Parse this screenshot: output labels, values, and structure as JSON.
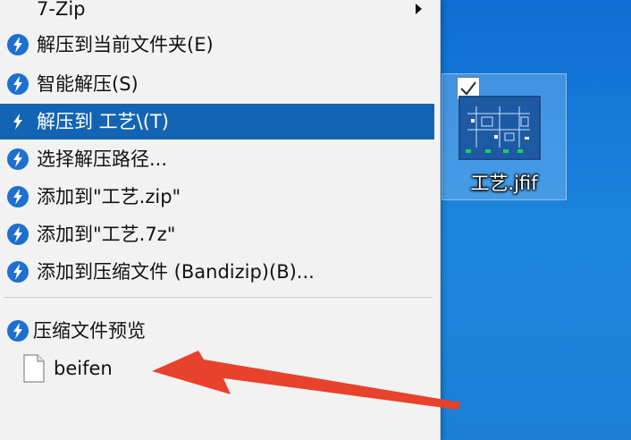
{
  "context_menu": {
    "items": [
      {
        "label": "7-Zip",
        "has_submenu": true,
        "icon": "none"
      },
      {
        "label": "解压到当前文件夹(E)",
        "icon": "bandizip-icon"
      },
      {
        "label": "智能解压(S)",
        "icon": "bandizip-icon"
      },
      {
        "label": "解压到 工艺\\(T)",
        "icon": "bandizip-icon",
        "highlighted": true
      },
      {
        "label": "选择解压路径...",
        "icon": "bandizip-icon"
      },
      {
        "label": "添加到\"工艺.zip\"",
        "icon": "bandizip-icon"
      },
      {
        "label": "添加到\"工艺.7z\"",
        "icon": "bandizip-icon"
      },
      {
        "label": "添加到压缩文件 (Bandizip)(B)...",
        "icon": "bandizip-icon"
      }
    ],
    "preview_section": {
      "label": "压缩文件预览",
      "icon": "bandizip-icon",
      "files": [
        {
          "name": "beifen",
          "icon": "file-icon"
        }
      ]
    }
  },
  "desktop": {
    "icon": {
      "label": "工艺.jfif",
      "selected": true,
      "checked": true
    }
  },
  "colors": {
    "menu_bg": "#f2f2f2",
    "highlight": "#1464b4",
    "desktop": "#1c86dc",
    "annotation_arrow": "#e8412c"
  }
}
